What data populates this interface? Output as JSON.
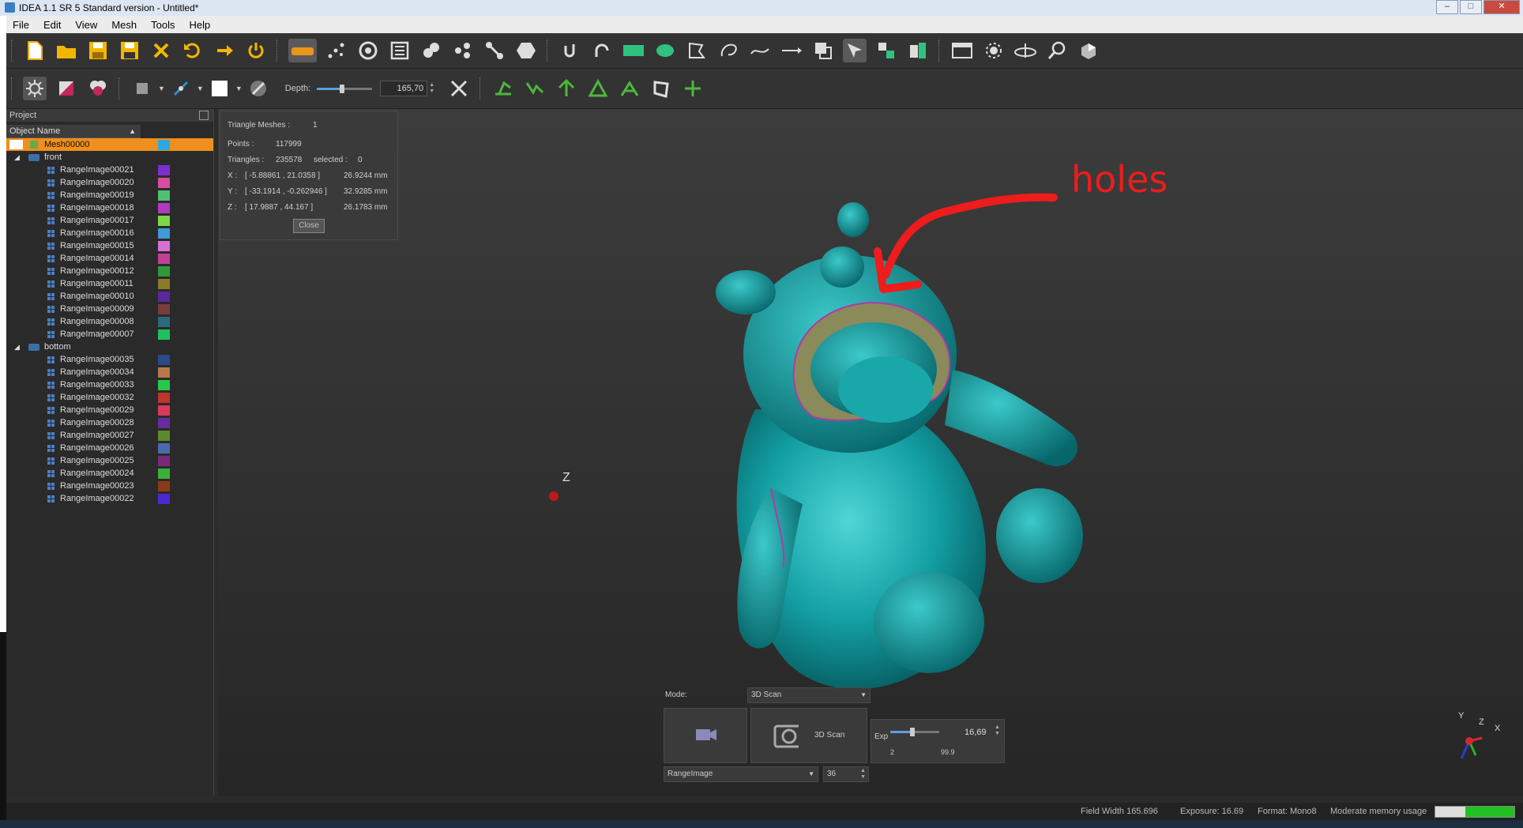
{
  "window": {
    "title": "IDEA 1.1 SR 5 Standard version - Untitled*"
  },
  "menu": [
    "File",
    "Edit",
    "View",
    "Mesh",
    "Tools",
    "Help"
  ],
  "toolbar2": {
    "depth_label": "Depth:",
    "depth_value": "165,70",
    "depth_fill": 0.45
  },
  "project_panel": {
    "title": "Project",
    "column_header": "Object Name",
    "selected_item": "Mesh00000",
    "groups": [
      {
        "name": "front",
        "items": [
          {
            "name": "RangeImage00021",
            "color": "#7b2fd0"
          },
          {
            "name": "RangeImage00020",
            "color": "#d94ca0"
          },
          {
            "name": "RangeImage00019",
            "color": "#4fbf73"
          },
          {
            "name": "RangeImage00018",
            "color": "#b03ac0"
          },
          {
            "name": "RangeImage00017",
            "color": "#7dd645"
          },
          {
            "name": "RangeImage00016",
            "color": "#3f9ad6"
          },
          {
            "name": "RangeImage00015",
            "color": "#d872d2"
          },
          {
            "name": "RangeImage00014",
            "color": "#c2409a"
          },
          {
            "name": "RangeImage00012",
            "color": "#2f9a3a"
          },
          {
            "name": "RangeImage00011",
            "color": "#8b7a2a"
          },
          {
            "name": "RangeImage00010",
            "color": "#5b2a9a"
          },
          {
            "name": "RangeImage00009",
            "color": "#7a3d3d"
          },
          {
            "name": "RangeImage00008",
            "color": "#2a6a7a"
          },
          {
            "name": "RangeImage00007",
            "color": "#1fc25a"
          }
        ]
      },
      {
        "name": "bottom",
        "items": [
          {
            "name": "RangeImage00035",
            "color": "#2a4a8a"
          },
          {
            "name": "RangeImage00034",
            "color": "#b8784a"
          },
          {
            "name": "RangeImage00033",
            "color": "#2ac84a"
          },
          {
            "name": "RangeImage00032",
            "color": "#c0342a"
          },
          {
            "name": "RangeImage00029",
            "color": "#d83a5a"
          },
          {
            "name": "RangeImage00028",
            "color": "#6a2aa0"
          },
          {
            "name": "RangeImage00027",
            "color": "#5a8a2a"
          },
          {
            "name": "RangeImage00026",
            "color": "#4a6ab0"
          },
          {
            "name": "RangeImage00025",
            "color": "#7a2a7a"
          },
          {
            "name": "RangeImage00024",
            "color": "#3ab03a"
          },
          {
            "name": "RangeImage00023",
            "color": "#8a3a1a"
          },
          {
            "name": "RangeImage00022",
            "color": "#4a2ad0"
          }
        ]
      }
    ]
  },
  "info": {
    "meshes_label": "Triangle Meshes :",
    "meshes_value": "1",
    "points_label": "Points :",
    "points_value": "117999",
    "triangles_label": "Triangles :",
    "triangles_value": "235578",
    "selected_label": "selected :",
    "selected_value": "0",
    "x_label": "X :",
    "x_range": "[ -5.88861 , 21.0358 ]",
    "x_size": "26.9244 mm",
    "y_label": "Y :",
    "y_range": "[ -33.1914 , -0.262946 ]",
    "y_size": "32.9285 mm",
    "z_label": "Z :",
    "z_range": "[ 17.9887 , 44.167 ]",
    "z_size": "26.1783 mm",
    "close_label": "Close"
  },
  "annotation": {
    "text": "holes",
    "color": "#ee1c1c"
  },
  "viewport": {
    "axis_label": "Z",
    "mesh_color": "#13a6a9"
  },
  "axis_gizmo": {
    "y": "Y",
    "z": "Z",
    "x": "X"
  },
  "scan": {
    "mode_label": "Mode:",
    "mode_value": "3D Scan",
    "scan_button": "3D Scan",
    "exp_label": "Exp",
    "exp_value": "16,69",
    "exp_min": "2",
    "exp_max": "99.9",
    "exp_fill": 0.45,
    "type_value": "RangeImage",
    "count_value": "36"
  },
  "status": {
    "field_width": "Field Width 165.696",
    "exposure": "Exposure: 16.69",
    "format": "Format: Mono8",
    "memory": "Moderate memory usage",
    "memory_fill": 0.62
  }
}
